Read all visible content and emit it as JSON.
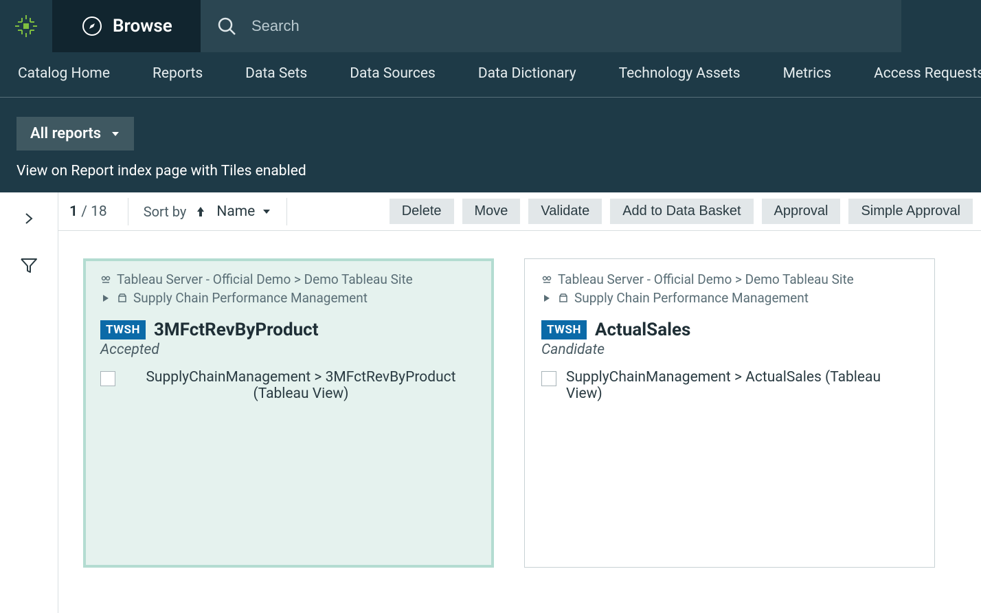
{
  "header": {
    "browse_label": "Browse",
    "search_placeholder": "Search"
  },
  "nav_tabs": {
    "items": [
      {
        "label": "Catalog Home",
        "active": false
      },
      {
        "label": "Reports",
        "active": true
      },
      {
        "label": "Data Sets",
        "active": false
      },
      {
        "label": "Data Sources",
        "active": false
      },
      {
        "label": "Data Dictionary",
        "active": false
      },
      {
        "label": "Technology Assets",
        "active": false
      },
      {
        "label": "Metrics",
        "active": false
      },
      {
        "label": "Access Requests",
        "active": false
      }
    ]
  },
  "sub_header": {
    "dropdown_label": "All reports",
    "description": "View on Report index page with Tiles enabled"
  },
  "toolbar": {
    "page_current": "1",
    "page_sep": " / ",
    "page_total": "18",
    "sortby_label": "Sort by",
    "sort_field": "Name",
    "actions": {
      "delete": "Delete",
      "move": "Move",
      "validate": "Validate",
      "add_to_basket": "Add to Data Basket",
      "approval": "Approval",
      "simple_approval": "Simple Approval"
    }
  },
  "tiles": [
    {
      "breadcrumb1": "Tableau Server - Official Demo > Demo Tableau Site",
      "breadcrumb2": "Supply Chain Performance Management",
      "badge": "TWSH",
      "title": "3MFctRevByProduct",
      "status": "Accepted",
      "link_text": "SupplyChainManagement > 3MFctRevByProduct (Tableau View)",
      "selected": true,
      "link_centered": true
    },
    {
      "breadcrumb1": "Tableau Server - Official Demo > Demo Tableau Site",
      "breadcrumb2": "Supply Chain Performance Management",
      "badge": "TWSH",
      "title": "ActualSales",
      "status": "Candidate",
      "link_text": "SupplyChainManagement > ActualSales (Tableau View)",
      "selected": false,
      "link_centered": false
    }
  ]
}
